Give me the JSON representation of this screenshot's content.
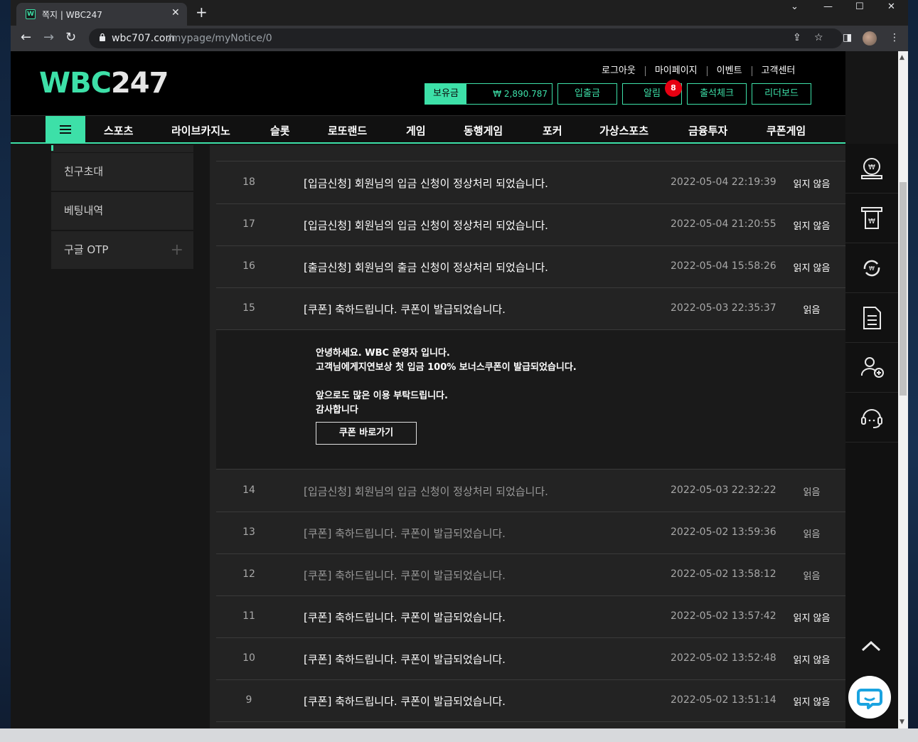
{
  "browser": {
    "tab_title": "쪽지 | WBC247",
    "favicon_letter": "W",
    "url_host": "wbc707.com",
    "url_path": "/mypage/myNotice/0"
  },
  "site": {
    "logo_part1": "WBC",
    "logo_part2": "247",
    "top_links": [
      "로그아웃",
      "마이페이지",
      "이벤트",
      "고객센터"
    ],
    "wallet_label": "보유금",
    "wallet_amount": "₩ 2,890.787",
    "header_buttons": [
      "입출금",
      "알림",
      "출석체크",
      "리더보드"
    ],
    "notification_count": "8",
    "nav": [
      "스포츠",
      "라이브카지노",
      "슬롯",
      "로또랜드",
      "게임",
      "동행게임",
      "포커",
      "가상스포츠",
      "금융투자",
      "쿠폰게임"
    ]
  },
  "sidebar": {
    "items": [
      {
        "label": "친구초대"
      },
      {
        "label": "베팅내역"
      },
      {
        "label": "구글 OTP"
      }
    ]
  },
  "notices": {
    "rows_before": [
      {
        "num": "18",
        "title": "[입금신청] 회원님의 입금 신청이 정상처리 되었습니다.",
        "date": "2022-05-04 22:19:39",
        "status": "읽지 않음"
      },
      {
        "num": "17",
        "title": "[입금신청] 회원님의 입금 신청이 정상처리 되었습니다.",
        "date": "2022-05-04 21:20:55",
        "status": "읽지 않음"
      },
      {
        "num": "16",
        "title": "[출금신청] 회원님의 출금 신청이 정상처리 되었습니다.",
        "date": "2022-05-04 15:58:26",
        "status": "읽지 않음"
      },
      {
        "num": "15",
        "title": "[쿠폰] 축하드립니다. 쿠폰이 발급되었습니다.",
        "date": "2022-05-03 22:35:37",
        "status": "읽음"
      }
    ],
    "detail": {
      "lines": [
        "안녕하세요. WBC 운영자 입니다.",
        "고객님에게지연보상 첫 입금 100% 보너스쿠폰이 발급되었습니다.",
        "앞으로도 많은 이용 부탁드립니다.",
        "감사합니다"
      ],
      "button": "쿠폰 바로가기"
    },
    "rows_after": [
      {
        "num": "14",
        "title": "[입금신청] 회원님의 입금 신청이 정상처리 되었습니다.",
        "date": "2022-05-03 22:32:22",
        "status": "읽음"
      },
      {
        "num": "13",
        "title": "[쿠폰] 축하드립니다. 쿠폰이 발급되었습니다.",
        "date": "2022-05-02 13:59:36",
        "status": "읽음"
      },
      {
        "num": "12",
        "title": "[쿠폰] 축하드립니다. 쿠폰이 발급되었습니다.",
        "date": "2022-05-02 13:58:12",
        "status": "읽음"
      },
      {
        "num": "11",
        "title": "[쿠폰] 축하드립니다. 쿠폰이 발급되었습니다.",
        "date": "2022-05-02 13:57:42",
        "status": "읽지 않음"
      },
      {
        "num": "10",
        "title": "[쿠폰] 축하드립니다. 쿠폰이 발급되었습니다.",
        "date": "2022-05-02 13:52:48",
        "status": "읽지 않음"
      },
      {
        "num": "9",
        "title": "[쿠폰] 축하드립니다. 쿠폰이 발급되었습니다.",
        "date": "2022-05-02 13:51:14",
        "status": "읽지 않음"
      }
    ]
  },
  "right_rail": {
    "icons": [
      "coin-icon",
      "withdraw-icon",
      "exchange-icon",
      "document-icon",
      "add-user-icon",
      "headset-icon"
    ]
  },
  "colors": {
    "accent": "#3de0a8",
    "badge": "#e60012",
    "page_bg": "#161616",
    "panel_bg": "#232323"
  }
}
